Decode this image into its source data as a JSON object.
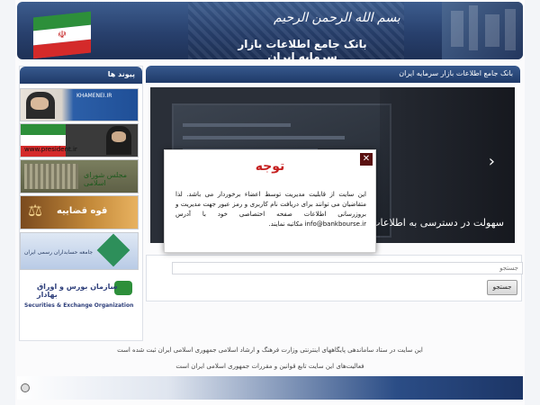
{
  "header": {
    "bismillah": "بسم الله الرحمن الرحیم",
    "title": "بانک جامع اطلاعات بازار سرمایه ایران"
  },
  "sidebar": {
    "title": "پیوند ها",
    "links": [
      {
        "label": "KHAMENEI.IR"
      },
      {
        "label": "www.president.ir"
      },
      {
        "label": "مجلس شورای اسلامی"
      },
      {
        "label": "قوه قضاییه"
      },
      {
        "label": "جامعه حسابداران رسمی ایران"
      },
      {
        "label": "سازمان بورس و اوراق بهادار",
        "sublabel": "Securities & Exchange Organization"
      }
    ]
  },
  "content": {
    "topbar_title": "بانک جامع اطلاعات بازار سرمایه ایران",
    "slider_caption": "سهولت در دسترسی به اطلاعات",
    "slider_next": "›"
  },
  "search": {
    "placeholder": "جستجو",
    "button_label": "جستجو"
  },
  "modal": {
    "title": "توجه",
    "close": "✕",
    "body": "این سایت از قابلیت مدیریت توسط اعضاء برخوردار می باشد. لذا متقاضیان می توانند برای دریافت نام کاربری و رمز عبور جهت مدیریت و بروزرسانی اطلاعات صفحه اختصاصی خود با آدرس info@bankbourse.ir مکاتبه نمایند."
  },
  "footer": {
    "line1": "این سایت در ستاد ساماندهی پایگاههای اینترنتی وزارت فرهنگ و ارشاد اسلامی جمهوری اسلامی ایران ثبت شده است",
    "line2": "فعالیت‌های این سایت تابع قوانین و مقررات جمهوری اسلامی ایران است"
  },
  "colors": {
    "header_blue": "#28406d",
    "modal_title_red": "#c62020",
    "flag_green": "#2d8f3a",
    "flag_red": "#d42a2a"
  }
}
